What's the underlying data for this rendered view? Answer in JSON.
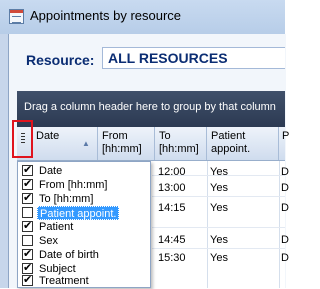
{
  "window": {
    "title": "Appointments by resource",
    "icon": "calendar-list-icon"
  },
  "resource": {
    "label": "Resource:",
    "value": "ALL RESOURCES"
  },
  "group_panel": {
    "text": "Drag a column header here to group by that column"
  },
  "grid": {
    "column_chooser_icon": "column-chooser-icon",
    "columns": [
      {
        "label": "Date",
        "sort": "ascending"
      },
      {
        "label": "From [hh:mm]"
      },
      {
        "label": "To [hh:mm]"
      },
      {
        "label": "Patient appoint."
      },
      {
        "label": "P"
      }
    ],
    "rows": [
      {
        "to": "12:00",
        "patient_appoint": "Yes",
        "next": "D"
      },
      {
        "to": "13:00",
        "patient_appoint": "Yes",
        "next": "D"
      },
      {
        "to": "14:15",
        "patient_appoint": "Yes",
        "next": "D"
      },
      {
        "to": "14:45",
        "patient_appoint": "Yes",
        "next": "D"
      },
      {
        "to": "15:30",
        "patient_appoint": "Yes",
        "next": "D"
      }
    ]
  },
  "column_chooser": {
    "items": [
      {
        "label": "Date",
        "checked": true
      },
      {
        "label": "From [hh:mm]",
        "checked": true
      },
      {
        "label": "To [hh:mm]",
        "checked": true
      },
      {
        "label": "Patient appoint.",
        "checked": false,
        "highlighted": true
      },
      {
        "label": "Patient",
        "checked": true
      },
      {
        "label": "Sex",
        "checked": false
      },
      {
        "label": "Date of birth",
        "checked": true
      },
      {
        "label": "Subject",
        "checked": true
      },
      {
        "label": "Treatment",
        "checked": true
      }
    ]
  }
}
